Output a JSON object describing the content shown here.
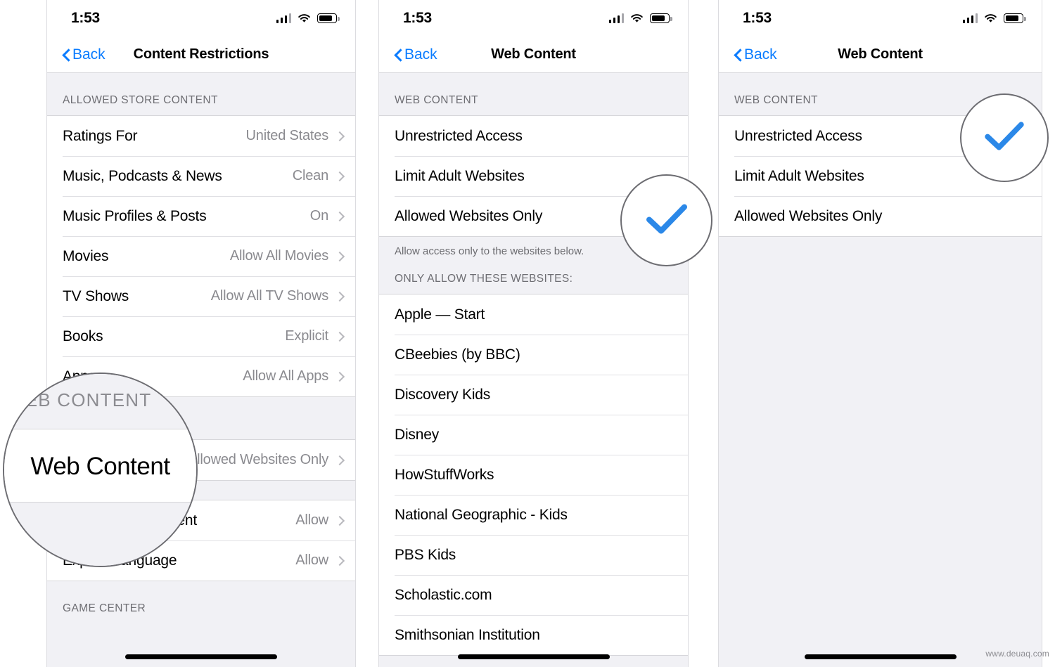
{
  "status_bar": {
    "time": "1:53",
    "cellular_icon": "cellular-signal-icon",
    "wifi_icon": "wifi-icon",
    "battery_icon": "battery-icon"
  },
  "panels": [
    {
      "id": "content-restrictions",
      "nav": {
        "back_label": "Back",
        "title": "Content Restrictions"
      },
      "sections": [
        {
          "header": "ALLOWED STORE CONTENT",
          "rows": [
            {
              "label": "Ratings For",
              "value": "United States"
            },
            {
              "label": "Music, Podcasts & News",
              "value": "Clean"
            },
            {
              "label": "Music Profiles & Posts",
              "value": "On"
            },
            {
              "label": "Movies",
              "value": "Allow All Movies"
            },
            {
              "label": "TV Shows",
              "value": "Allow All TV Shows"
            },
            {
              "label": "Books",
              "value": "Explicit"
            },
            {
              "label": "Apps",
              "value": "Allow All Apps"
            }
          ]
        },
        {
          "header": "WEB CONTENT",
          "rows": [
            {
              "label": "Web Content",
              "value": "Allowed Websites Only"
            }
          ]
        },
        {
          "header": "",
          "rows": [
            {
              "label": "Web Search Content",
              "value": "Allow"
            },
            {
              "label": "Explicit Language",
              "value": "Allow"
            }
          ]
        },
        {
          "header": "GAME CENTER",
          "rows": []
        }
      ],
      "magnifier": {
        "label": "Web Content",
        "ghost_header": "WEB CONTENT"
      }
    },
    {
      "id": "web-content-allowed",
      "nav": {
        "back_label": "Back",
        "title": "Web Content"
      },
      "section_header": "WEB CONTENT",
      "options": [
        {
          "label": "Unrestricted Access",
          "checked": false
        },
        {
          "label": "Limit Adult Websites",
          "checked": false
        },
        {
          "label": "Allowed Websites Only",
          "checked": true
        }
      ],
      "footnote": "Allow access only to the websites below.",
      "list_header": "ONLY ALLOW THESE WEBSITES:",
      "websites": [
        "Apple — Start",
        "CBeebies (by BBC)",
        "Discovery Kids",
        "Disney",
        "HowStuffWorks",
        "National Geographic - Kids",
        "PBS Kids",
        "Scholastic.com",
        "Smithsonian Institution"
      ],
      "magnifier": {
        "icon": "checkmark-icon"
      }
    },
    {
      "id": "web-content-unrestricted",
      "nav": {
        "back_label": "Back",
        "title": "Web Content"
      },
      "section_header": "WEB CONTENT",
      "options": [
        {
          "label": "Unrestricted Access",
          "checked": true
        },
        {
          "label": "Limit Adult Websites",
          "checked": false
        },
        {
          "label": "Allowed Websites Only",
          "checked": false
        }
      ],
      "magnifier": {
        "icon": "checkmark-icon"
      }
    }
  ],
  "colors": {
    "accent_blue": "#0a7cff",
    "checkmark_blue": "#2b88e8",
    "group_bg": "#f1f1f5",
    "separator": "#e0e0e4",
    "secondary_text": "#8a8a8f"
  },
  "watermark": "www.deuaq.com"
}
